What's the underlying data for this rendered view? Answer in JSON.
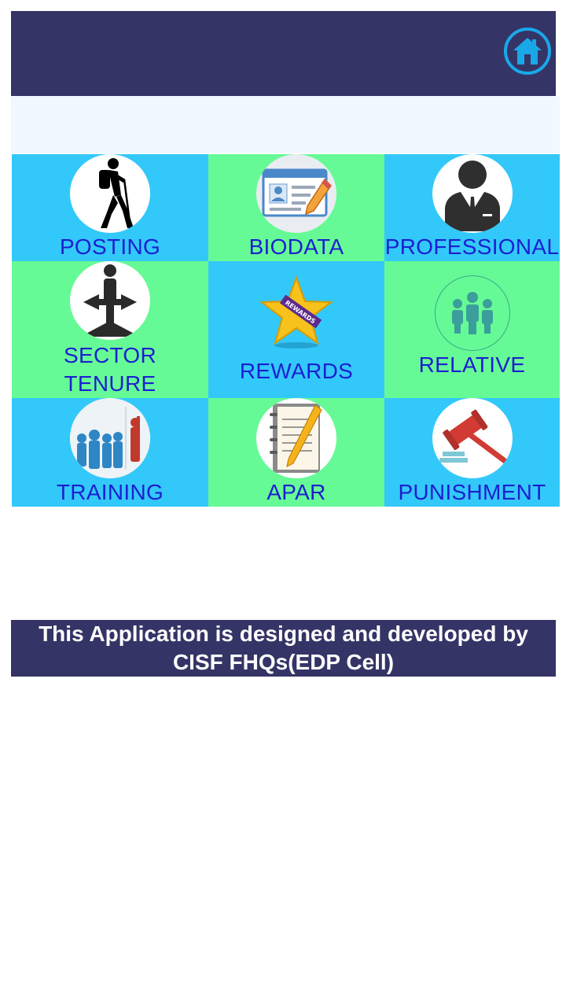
{
  "header": {
    "home_icon": "home-icon"
  },
  "tiles": [
    {
      "label": "POSTING",
      "icon": "hiker-icon"
    },
    {
      "label": "BIODATA",
      "icon": "id-card-icon"
    },
    {
      "label": "PROFESSIONAL",
      "icon": "businessman-icon"
    },
    {
      "label_line1": "SECTOR",
      "label_line2": "TENURE",
      "icon": "crossroads-person-icon"
    },
    {
      "label": "REWARDS",
      "icon": "star-badge-icon",
      "badge_text": "REWARDS"
    },
    {
      "label": "RELATIVE",
      "icon": "people-group-icon"
    },
    {
      "label": "TRAINING",
      "icon": "people-crowd-icon"
    },
    {
      "label": "APAR",
      "icon": "notepad-pencil-icon"
    },
    {
      "label": "PUNISHMENT",
      "icon": "gavel-icon"
    }
  ],
  "footer": {
    "line1": "This Application is designed and developed by",
    "line2": "CISF FHQs(EDP Cell)"
  },
  "colors": {
    "header_bg": "#353466",
    "tile_blue": "#33c8fa",
    "tile_green": "#66fa96",
    "label": "#1c1fd0",
    "accent": "#1aa7e8"
  }
}
